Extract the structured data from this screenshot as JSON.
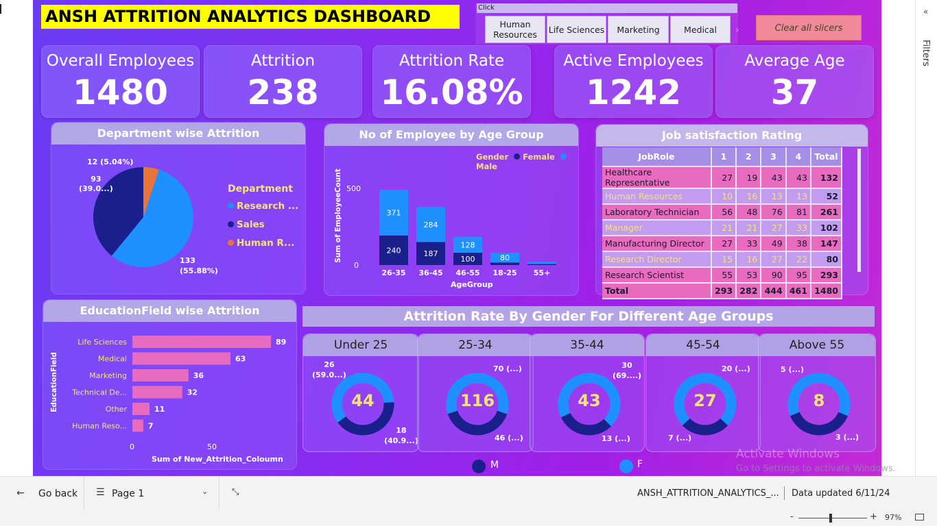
{
  "dashboard": {
    "title": "ANSH ATTRITION ANALYTICS DASHBOARD",
    "slicer": {
      "header": "Click",
      "options": [
        "Human Resources",
        "Life Sciences",
        "Marketing",
        "Medical"
      ],
      "more_arrow": "›"
    },
    "clear_button": "Clear all slicers"
  },
  "kpis": [
    {
      "label": "Overall Employees",
      "value": "1480"
    },
    {
      "label": "Attrition",
      "value": "238"
    },
    {
      "label": "Attrition Rate",
      "value": "16.08%"
    },
    {
      "label": "Active Employees",
      "value": "1242"
    },
    {
      "label": "Average Age",
      "value": "37"
    }
  ],
  "dept_chart": {
    "title": "Department wise Attrition",
    "legend_title": "Department",
    "legend": [
      "Research ...",
      "Sales",
      "Human R..."
    ],
    "labels": [
      "133",
      "(55.88%)",
      "93",
      "(39.0...)",
      "12 (5.04%)"
    ]
  },
  "age_chart": {
    "title": "No of Employee by Age Group",
    "legend_label": "Gender",
    "legend": [
      "Female",
      "Male"
    ],
    "ylabel": "Sum of EmployeeCount",
    "xlabel": "AgeGroup",
    "yticks": [
      "500",
      "0"
    ],
    "data_labels": [
      "371",
      "240",
      "284",
      "187",
      "128",
      "100",
      "80"
    ]
  },
  "job_table": {
    "title": "Job satisfaction Rating",
    "headers": [
      "JobRole",
      "1",
      "2",
      "3",
      "4",
      "Total"
    ],
    "rows": [
      [
        "Healthcare Representative",
        "27",
        "19",
        "43",
        "43",
        "132"
      ],
      [
        "Human Resources",
        "10",
        "16",
        "13",
        "13",
        "52"
      ],
      [
        "Laboratory Technician",
        "56",
        "48",
        "76",
        "81",
        "261"
      ],
      [
        "Manager",
        "21",
        "21",
        "27",
        "33",
        "102"
      ],
      [
        "Manufacturing Director",
        "27",
        "33",
        "49",
        "38",
        "147"
      ],
      [
        "Research Director",
        "15",
        "16",
        "27",
        "22",
        "80"
      ],
      [
        "Research Scientist",
        "55",
        "53",
        "90",
        "95",
        "293"
      ]
    ],
    "total": [
      "Total",
      "293",
      "282",
      "444",
      "461",
      "1480"
    ]
  },
  "edu_chart": {
    "title": "EducationField wise Attrition",
    "ylabel": "EducationField",
    "xlabel": "Sum of New_Attrition_Coloumn",
    "xticks": [
      "0",
      "50"
    ],
    "categories": [
      "Life Sciences",
      "Medical",
      "Marketing",
      "Technical De...",
      "Other",
      "Human Reso..."
    ],
    "value_labels": [
      "89",
      "63",
      "36",
      "32",
      "11",
      "7"
    ]
  },
  "gender_section": {
    "title": "Attrition Rate By Gender For Different Age Groups",
    "legend": [
      "M",
      "F"
    ],
    "gauges": [
      {
        "title": "Under 25",
        "center": "44",
        "top_label": "26\n(59.0...)",
        "bottom_label": "18\n(40.9...)"
      },
      {
        "title": "25-34",
        "center": "116",
        "top_label": "70 (...)",
        "bottom_label": "46 (...)"
      },
      {
        "title": "35-44",
        "center": "43",
        "top_label": "30\n(69....)",
        "bottom_label": "13 (...)"
      },
      {
        "title": "45-54",
        "center": "27",
        "top_label": "20 (...)",
        "bottom_label": "7 (...)"
      },
      {
        "title": "Above 55",
        "center": "8",
        "top_label": "5 (...)",
        "bottom_label": "3 (...)"
      }
    ]
  },
  "watermark": {
    "line1": "Activate Windows",
    "line2": "Go to Settings to activate Windows."
  },
  "bottom": {
    "go_back": "Go back",
    "page": "Page 1",
    "report_name": "ANSH_ATTRITION_ANALYTICS_...",
    "updated": "Data updated 6/11/24",
    "zoom": "97%"
  },
  "filters_label": "Filters",
  "colors": {
    "male": "#1a1f8c",
    "female": "#1e90ff",
    "hr": "#e8743b",
    "accent_yellow": "#f6e27a",
    "pink_bar": "#e96bc0"
  },
  "chart_data": [
    {
      "type": "pie",
      "title": "Department wise Attrition",
      "categories": [
        "Research ...",
        "Sales",
        "Human R..."
      ],
      "values": [
        133,
        93,
        12
      ]
    },
    {
      "type": "bar",
      "title": "No of Employee by Age Group",
      "categories": [
        "26-35",
        "36-45",
        "46-55",
        "18-25",
        "55+"
      ],
      "xlabel": "AgeGroup",
      "ylabel": "Sum of EmployeeCount",
      "stacked": true,
      "series": [
        {
          "name": "Male",
          "values": [
            371,
            284,
            128,
            80,
            18
          ]
        },
        {
          "name": "Female",
          "values": [
            240,
            187,
            100,
            20,
            8
          ]
        }
      ],
      "ylim": [
        0,
        650
      ]
    },
    {
      "type": "bar",
      "orientation": "horizontal",
      "title": "EducationField wise Attrition",
      "categories": [
        "Life Sciences",
        "Medical",
        "Marketing",
        "Technical De...",
        "Other",
        "Human Reso..."
      ],
      "values": [
        89,
        63,
        36,
        32,
        11,
        7
      ],
      "xlabel": "Sum of New_Attrition_Coloumn",
      "ylabel": "EducationField",
      "xlim": [
        0,
        100
      ]
    }
  ]
}
